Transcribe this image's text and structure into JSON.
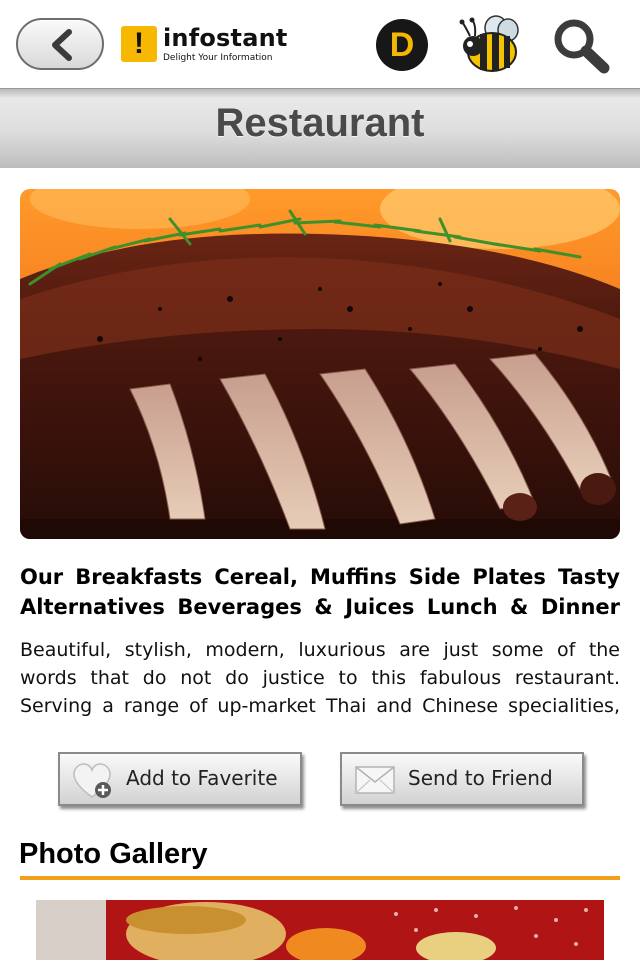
{
  "header": {
    "logo": {
      "mark": "!",
      "name": "infostant",
      "tagline": "Delight Your Information"
    },
    "d_label": "D",
    "icons": {
      "back": "chevron-left-icon",
      "bee": "bee-icon",
      "search": "search-icon"
    }
  },
  "page": {
    "title": "Restaurant"
  },
  "hero": {
    "image": "grilled-rack-of-lamb-photo"
  },
  "article": {
    "headline": "Our Breakfasts Cereal, Muffins Side Plates Tasty Alternatives Beverages & Juices Lunch & Dinner",
    "body": "Beautiful, stylish, modern, luxurious are just some of the words that do not do justice to this fabulous restaurant. Serving a range of up-market Thai and Chinese specialities,"
  },
  "actions": {
    "favorite_label": "Add to Faverite",
    "send_label": "Send to Friend"
  },
  "gallery": {
    "title": "Photo Gallery"
  },
  "colors": {
    "accent": "#f0a11c",
    "brand_yellow": "#f6b800",
    "title_text": "#4a4a4a"
  }
}
